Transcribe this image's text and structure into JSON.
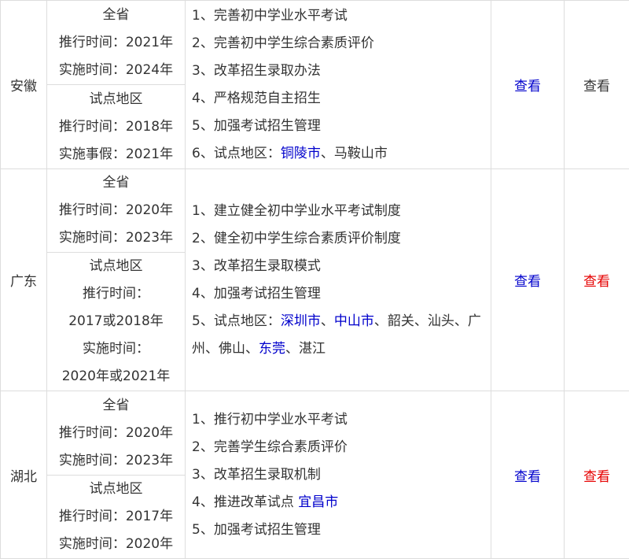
{
  "rows": [
    {
      "province": "安徽",
      "full": {
        "label": "全省",
        "promote": "推行时间：2021年",
        "implement": "实施时间：2024年"
      },
      "pilot": {
        "label": "试点地区",
        "promote": "推行时间：2018年",
        "implement": "实施事假：2021年"
      },
      "items": [
        "1、完善初中学业水平考试",
        "2、完善初中学生综合素质评价",
        "3、改革招生录取办法",
        "4、严格规范自主招生",
        "5、加强考试招生管理"
      ],
      "pilot_item": {
        "prefix": "6、试点地区：",
        "city_link": "铜陵市",
        "sep": "、",
        "rest": "马鞍山市"
      },
      "view_blue": "查看",
      "view_other": "查看",
      "view_other_color": "#333333"
    },
    {
      "province": "广东",
      "full": {
        "label": "全省",
        "promote": "推行时间：2020年",
        "implement": "实施时间：2023年"
      },
      "pilot": {
        "label": "试点地区",
        "promote": "推行时间：",
        "promote_value": "2017或2018年",
        "implement": "实施时间：",
        "implement_value": "2020年或2021年"
      },
      "items": [
        "1、建立健全初中学业水平考试制度",
        "2、健全初中学生综合素质评价制度",
        "3、改革招生录取模式",
        "4、加强考试招生管理"
      ],
      "pilot_item": {
        "prefix": "5、试点地区：",
        "link1": "深圳市",
        "sep1": "、",
        "link2": "中山市",
        "mid": "、韶关、汕头、广州、佛山、",
        "link3": "东莞",
        "tail": "、湛江"
      },
      "view_blue": "查看",
      "view_other": "查看",
      "view_other_color": "#e60000"
    },
    {
      "province": "湖北",
      "full": {
        "label": "全省",
        "promote": "推行时间：2020年",
        "implement": "实施时间：2023年"
      },
      "pilot": {
        "label": "试点地区",
        "promote": "推行时间：2017年",
        "implement": "实施时间：2020年"
      },
      "items": [
        "1、推行初中学业水平考试",
        "2、完善学生综合素质评价",
        "3、改革招生录取机制"
      ],
      "pilot_item": {
        "prefix": "4、推进改革试点 ",
        "city_link": "宜昌市"
      },
      "last_item": "5、加强考试招生管理",
      "view_blue": "查看",
      "view_other": "查看",
      "view_other_color": "#e60000"
    }
  ],
  "colors": {
    "link_blue": "#0000cc",
    "link_red": "#e60000",
    "text": "#333333",
    "border": "#dddddd"
  }
}
